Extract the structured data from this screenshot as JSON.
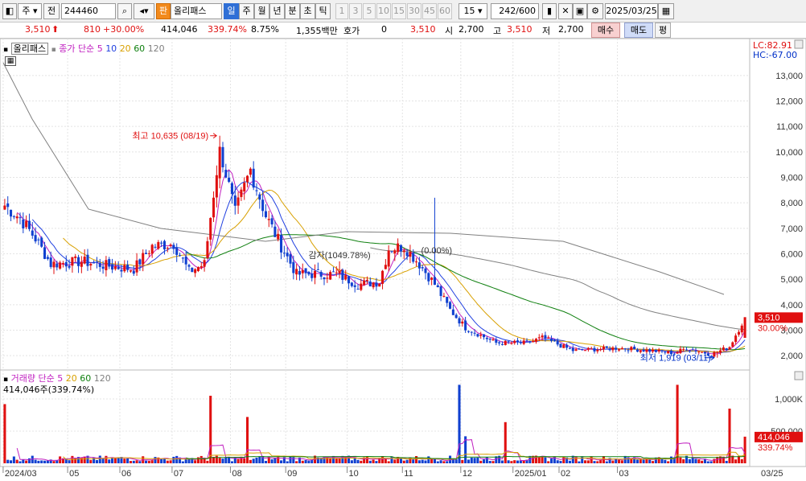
{
  "toolbar": {
    "market": "주",
    "prev": "전",
    "code": "244460",
    "badge": "판",
    "name": "올리패스",
    "periods": [
      "일",
      "주",
      "월",
      "년",
      "분",
      "초",
      "틱"
    ],
    "minutes": [
      "1",
      "3",
      "5",
      "10",
      "15",
      "30",
      "45",
      "60"
    ],
    "interval": "15",
    "count": "242",
    "count_total": "/600",
    "date": "2025/03/25"
  },
  "quote": {
    "price": "3,510",
    "change": "810",
    "change_pct": "+30.00%",
    "volume": "414,046",
    "volume_ratio": "339.74%",
    "turnover": "8.75%",
    "amount": "1,355백만",
    "ask_label": "호가",
    "ask_value": "0",
    "bid": "3,510",
    "open_label": "시",
    "open": "2,700",
    "high_label": "고",
    "high": "3,510",
    "low_label": "저",
    "low": "2,700",
    "buy": "매수",
    "sell": "매도",
    "avg": "평"
  },
  "price_legend": {
    "name": "올리패스",
    "ma_label": "종가 단순",
    "periods": [
      "5",
      "10",
      "20",
      "60",
      "120"
    ]
  },
  "volume_legend": {
    "label": "거래량 단순",
    "periods": [
      "5",
      "20",
      "60",
      "120"
    ],
    "value": "414,046주(339.74%)"
  },
  "chart_data": {
    "type": "candlestick",
    "y_ticks": [
      "13,000",
      "12,000",
      "11,000",
      "10,000",
      "9,000",
      "8,000",
      "7,000",
      "6,000",
      "5,000",
      "4,000",
      "3,000",
      "2,000"
    ],
    "vol_ticks": [
      "1,000K",
      "500,000"
    ],
    "x_ticks": [
      "2024/03",
      "05",
      "06",
      "07",
      "08",
      "09",
      "10",
      "11",
      "12",
      "2025/01",
      "02",
      "03",
      "03/25"
    ],
    "lc": "LC:82.91",
    "hc": "HC:-67.00",
    "cur_price": "3,510",
    "cur_pct": "30.00%",
    "cur_vol": "414,046",
    "cur_vol_pct": "339.74%",
    "annotations": [
      {
        "text": "최고 10,635 (08/19)",
        "idx": 70,
        "price": 10635
      },
      {
        "text": "감자(1049.78%)",
        "idx": 109,
        "price": 5200
      },
      {
        "text": "(0.00%)",
        "idx": 138,
        "price": 5200
      },
      {
        "text": "최저 1,919 (03/11)",
        "idx": 232,
        "price": 1919
      }
    ],
    "anchors": [
      [
        0,
        7900
      ],
      [
        5,
        7400
      ],
      [
        10,
        6600
      ],
      [
        15,
        5600
      ],
      [
        25,
        5700
      ],
      [
        35,
        5500
      ],
      [
        42,
        5400
      ],
      [
        48,
        6300
      ],
      [
        55,
        6400
      ],
      [
        60,
        5300
      ],
      [
        65,
        5600
      ],
      [
        70,
        10200
      ],
      [
        75,
        7600
      ],
      [
        80,
        9300
      ],
      [
        85,
        7500
      ],
      [
        90,
        6300
      ],
      [
        95,
        5200
      ],
      [
        108,
        5200
      ],
      [
        115,
        4800
      ],
      [
        122,
        4900
      ],
      [
        125,
        6200
      ],
      [
        130,
        6300
      ],
      [
        135,
        5600
      ],
      [
        140,
        4800
      ],
      [
        145,
        3800
      ],
      [
        150,
        3100
      ],
      [
        160,
        2500
      ],
      [
        170,
        2500
      ],
      [
        175,
        2700
      ],
      [
        185,
        2200
      ],
      [
        200,
        2300
      ],
      [
        210,
        2200
      ],
      [
        218,
        2100
      ],
      [
        222,
        2300
      ],
      [
        230,
        2050
      ],
      [
        236,
        2350
      ],
      [
        241,
        3510
      ]
    ],
    "volume_spikes": [
      [
        0,
        920000
      ],
      [
        67,
        1050000
      ],
      [
        79,
        720000
      ],
      [
        148,
        1220000
      ],
      [
        150,
        420000
      ],
      [
        163,
        640000
      ],
      [
        219,
        1220000
      ],
      [
        236,
        850000
      ]
    ]
  }
}
